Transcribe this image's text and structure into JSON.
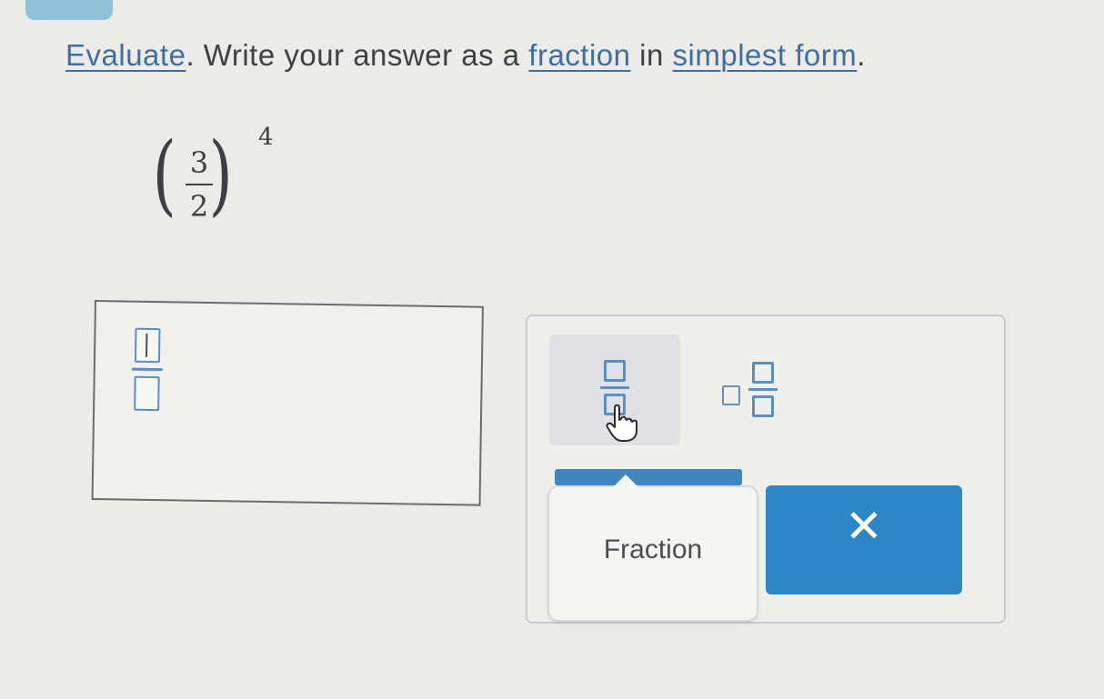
{
  "question": {
    "word1": "Evaluate",
    "text1": ". Write your answer as a ",
    "word2": "fraction",
    "text2": " in ",
    "word3": "simplest form",
    "text3": "."
  },
  "expression": {
    "open_paren": "(",
    "numerator": "3",
    "denominator": "2",
    "close_paren": ")",
    "exponent": "4"
  },
  "keypad": {
    "tooltip_label": "Fraction",
    "clear_label": "✕"
  },
  "icons": [
    "fraction-icon",
    "mixed-number-icon",
    "pointer-hand-icon",
    "close-icon"
  ],
  "colors": {
    "accent": "#2f86c6",
    "link": "#3e6fa0",
    "slot_border": "#5b8fc3",
    "background": "#ecebe7"
  }
}
